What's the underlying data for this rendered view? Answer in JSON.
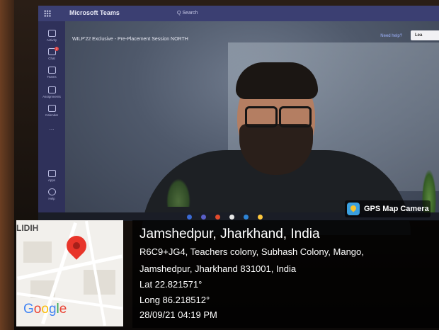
{
  "teams": {
    "brand": "Microsoft Teams",
    "search": "Q Search",
    "meeting_title": "WILP'22 Exclusive - Pre-Placement Session NORTH",
    "need_help": "Need help?",
    "leave": "Lea",
    "rail": [
      {
        "label": "Activity"
      },
      {
        "label": "Chat",
        "badge": "2"
      },
      {
        "label": "Teams"
      },
      {
        "label": "Assignments"
      },
      {
        "label": "Calendar"
      },
      {
        "label": "..."
      },
      {
        "label": "Apps"
      },
      {
        "label": "Help"
      }
    ]
  },
  "gps": {
    "app_label": "GPS Map Camera",
    "map_place": "LIDIH",
    "map_brand": "Google",
    "title": "Jamshedpur, Jharkhand, India",
    "address_line1": "R6C9+JG4, Teachers colony, Subhash Colony, Mango,",
    "address_line2": "Jamshedpur, Jharkhand 831001, India",
    "lat": "Lat 22.821571°",
    "long": "Long 86.218512°",
    "datetime": "28/09/21 04:19 PM"
  },
  "colors": {
    "teams_bar": "#3b3f72",
    "pin": "#e8352a",
    "overlay": "rgba(0,0,0,0.72)"
  }
}
